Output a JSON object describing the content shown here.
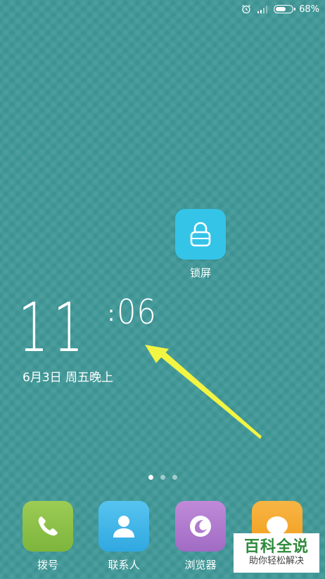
{
  "colors": {
    "wallpaper": "#3f9898",
    "lock_icon_bg": "#34c4e8",
    "phone_icon_bg": "#8bc34a",
    "contacts_icon_bg": "#3fb4e8",
    "browser_icon_bg": "#b07ccf",
    "messages_icon_bg": "#f5a623",
    "arrow": "#f2f542",
    "watermark_text": "#2f8a3c"
  },
  "status_bar": {
    "battery_percent": "68%",
    "battery_level": 0.68,
    "icons": [
      "alarm-icon",
      "signal-icon",
      "battery-icon"
    ]
  },
  "lock_app": {
    "label": "锁屏",
    "icon": "padlock-icon"
  },
  "clock": {
    "hour": "11",
    "separator": ":",
    "minute": "06",
    "date": "6月3日 周五晚上"
  },
  "page_dots": {
    "count": 3,
    "active_index": 0
  },
  "dock": {
    "apps": [
      {
        "label": "拨号",
        "icon": "phone-icon"
      },
      {
        "label": "联系人",
        "icon": "contacts-icon"
      },
      {
        "label": "浏览器",
        "icon": "browser-icon"
      },
      {
        "label": "",
        "icon": "messages-icon"
      }
    ]
  },
  "watermark": {
    "title": "百科全说",
    "subtitle": "助你轻松解决"
  }
}
